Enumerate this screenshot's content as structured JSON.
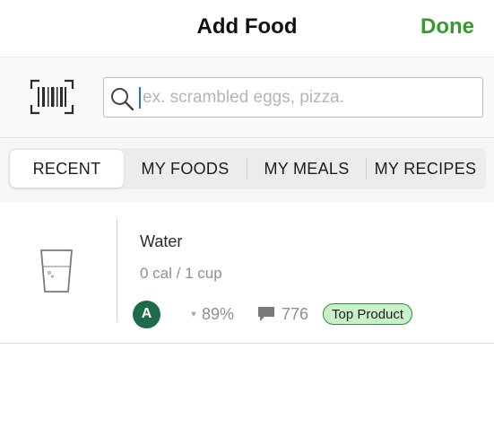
{
  "header": {
    "title": "Add Food",
    "done_label": "Done"
  },
  "search": {
    "value": "",
    "placeholder": "ex. scrambled eggs, pizza."
  },
  "tabs": [
    {
      "label": "RECENT",
      "active": true
    },
    {
      "label": "MY FOODS",
      "active": false
    },
    {
      "label": "MY MEALS",
      "active": false
    },
    {
      "label": "MY RECIPES",
      "active": false
    }
  ],
  "items": [
    {
      "name": "Water",
      "calories": "0 cal / 1 cup",
      "avatar_letter": "A",
      "rating": "89%",
      "comments": "776",
      "badge": "Top Product",
      "icon": "water-glass-icon"
    }
  ],
  "colors": {
    "accent": "#3a9a32",
    "avatar": "#1d6b4a",
    "badge_bg": "#c9f0c7",
    "badge_border": "#2f8a45",
    "caret": "#2f6bdb"
  }
}
